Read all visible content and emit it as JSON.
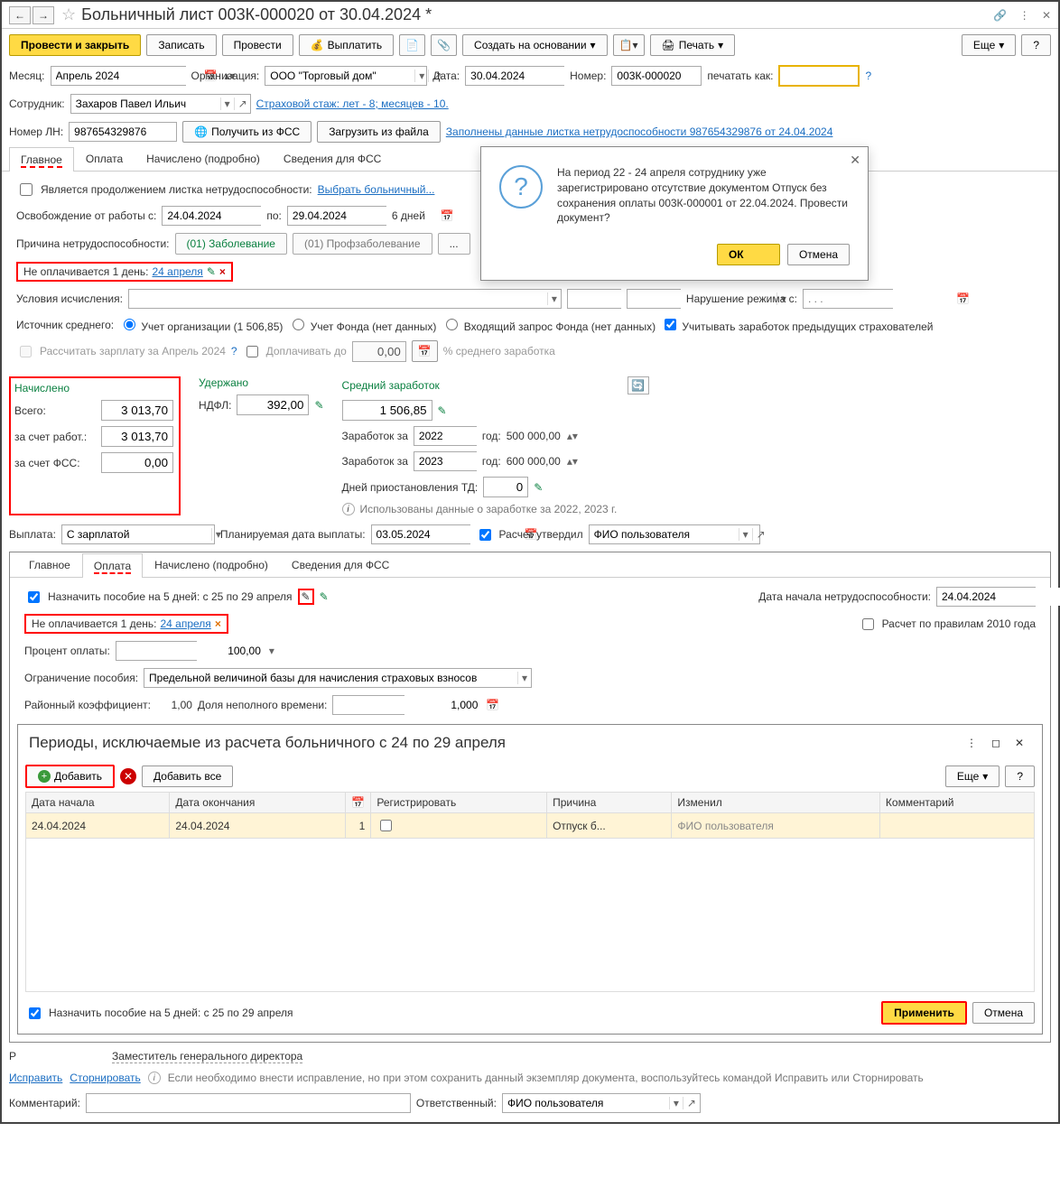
{
  "title": "Больничный лист 003К-000020 от 30.04.2024 *",
  "toolbar": {
    "post_close": "Провести и закрыть",
    "save": "Записать",
    "post": "Провести",
    "pay": "Выплатить",
    "create_based": "Создать на основании",
    "print": "Печать",
    "more": "Еще"
  },
  "header": {
    "month_label": "Месяц:",
    "month_value": "Апрель 2024",
    "org_label": "Организация:",
    "org_value": "ООО \"Торговый дом\"",
    "date_label": "Дата:",
    "date_value": "30.04.2024",
    "number_label": "Номер:",
    "number_value": "003К-000020",
    "print_as_label": "печатать как:",
    "employee_label": "Сотрудник:",
    "employee_value": "Захаров Павел Ильич",
    "experience_link": "Страховой стаж: лет - 8; месяцев - 10.",
    "ln_label": "Номер ЛН:",
    "ln_value": "987654329876",
    "get_fss": "Получить из ФСС",
    "load_file": "Загрузить из файла",
    "filled_link": "Заполнены данные листка нетрудоспособности 987654329876 от 24.04.2024"
  },
  "tabs": {
    "main": "Главное",
    "payment": "Оплата",
    "detailed": "Начислено (подробно)",
    "fss": "Сведения для ФСС"
  },
  "main_tab": {
    "continuation_label": "Является продолжением листка нетрудоспособности:",
    "select_sick": "Выбрать больничный...",
    "release_from": "Освобождение от работы с:",
    "date_from": "24.04.2024",
    "to": "по:",
    "date_to": "29.04.2024",
    "days": "6 дней",
    "cause_label": "Причина нетрудоспособности:",
    "cause1": "(01) Заболевание",
    "cause2": "(01) Профзаболевание",
    "not_paid": "Не оплачивается 1 день:",
    "not_paid_link": "24 апреля",
    "calc_conditions": "Условия исчисления:",
    "violation_label": "Нарушение режима с:",
    "avg_source": "Источник среднего:",
    "src_org": "Учет организации (1 506,85)",
    "src_fund": "Учет Фонда (нет данных)",
    "src_request": "Входящий запрос Фонда (нет данных)",
    "prev_insurers": "Учитывать заработок предыдущих страхователей",
    "recalc_salary": "Рассчитать зарплату за Апрель 2024",
    "top_up": "Доплачивать до",
    "top_up_val": "0,00",
    "top_up_pct": "% среднего заработка"
  },
  "calc": {
    "accrued": "Начислено",
    "total": "Всего:",
    "total_val": "3 013,70",
    "employer": "за счет работ.:",
    "employer_val": "3 013,70",
    "fss": "за счет ФСС:",
    "fss_val": "0,00",
    "withheld": "Удержано",
    "ndfl": "НДФЛ:",
    "ndfl_val": "392,00",
    "avg_earn": "Средний заработок",
    "avg_val": "1 506,85",
    "earn_for": "Заработок за",
    "year1": "2022",
    "year1_val": "500 000,00",
    "year2": "2023",
    "year2_val": "600 000,00",
    "year_label": "год:",
    "suspend_days": "Дней приостановления ТД:",
    "suspend_val": "0",
    "used_data": "Использованы данные о заработке за  2022,  2023 г."
  },
  "payout": {
    "label": "Выплата:",
    "value": "С зарплатой",
    "planned_label": "Планируемая дата выплаты:",
    "planned_date": "03.05.2024",
    "approved_label": "Расчет утвердил",
    "approved_by": "ФИО пользователя"
  },
  "payment_tab": {
    "assign_benefit": "Назначить пособие на 5 дней:  с 25 по 29 апреля",
    "not_paid": "Не оплачивается 1 день:",
    "not_paid_link": "24 апреля",
    "start_date_label": "Дата начала нетрудоспособности:",
    "start_date": "24.04.2024",
    "rules_2010": "Расчет по правилам 2010 года",
    "pct_label": "Процент оплаты:",
    "pct_val": "100,00",
    "limit_label": "Ограничение пособия:",
    "limit_value": "Предельной величиной базы для начисления страховых взносов",
    "district_coef": "Районный коэффициент:",
    "district_val": "1,00",
    "partial_label": "Доля неполного времени:",
    "partial_val": "1,000"
  },
  "modal": {
    "title": "Периоды, исключаемые из расчета больничного с 24 по 29 апреля",
    "add": "Добавить",
    "add_all": "Добавить все",
    "more": "Еще",
    "col_start": "Дата начала",
    "col_end": "Дата окончания",
    "col_reg": "Регистрировать",
    "col_reason": "Причина",
    "col_changed": "Изменил",
    "col_comment": "Комментарий",
    "row_start": "24.04.2024",
    "row_end": "24.04.2024",
    "row_days": "1",
    "row_reason": "Отпуск б...",
    "row_changed": "ФИО пользователя",
    "assign_benefit_chk": "Назначить пособие на 5 дней:  с 25 по 29 апреля",
    "apply": "Применить",
    "cancel": "Отмена"
  },
  "confirm": {
    "text": "На период 22 - 24 апреля сотруднику уже зарегистрировано отсутствие документом Отпуск без сохранения оплаты 003К-000001 от 22.04.2024. Провести документ?",
    "ok": "ОК",
    "cancel": "Отмена"
  },
  "footer": {
    "r_prefix": "Р",
    "deputy": "Заместитель генерального директора",
    "fix": "Исправить",
    "reverse": "Сторнировать",
    "fix_hint": "Если необходимо внести исправление, но при этом сохранить данный экземпляр документа, воспользуйтесь командой Исправить или Сторнировать",
    "comment_label": "Комментарий:",
    "responsible_label": "Ответственный:",
    "responsible_value": "ФИО пользователя"
  }
}
